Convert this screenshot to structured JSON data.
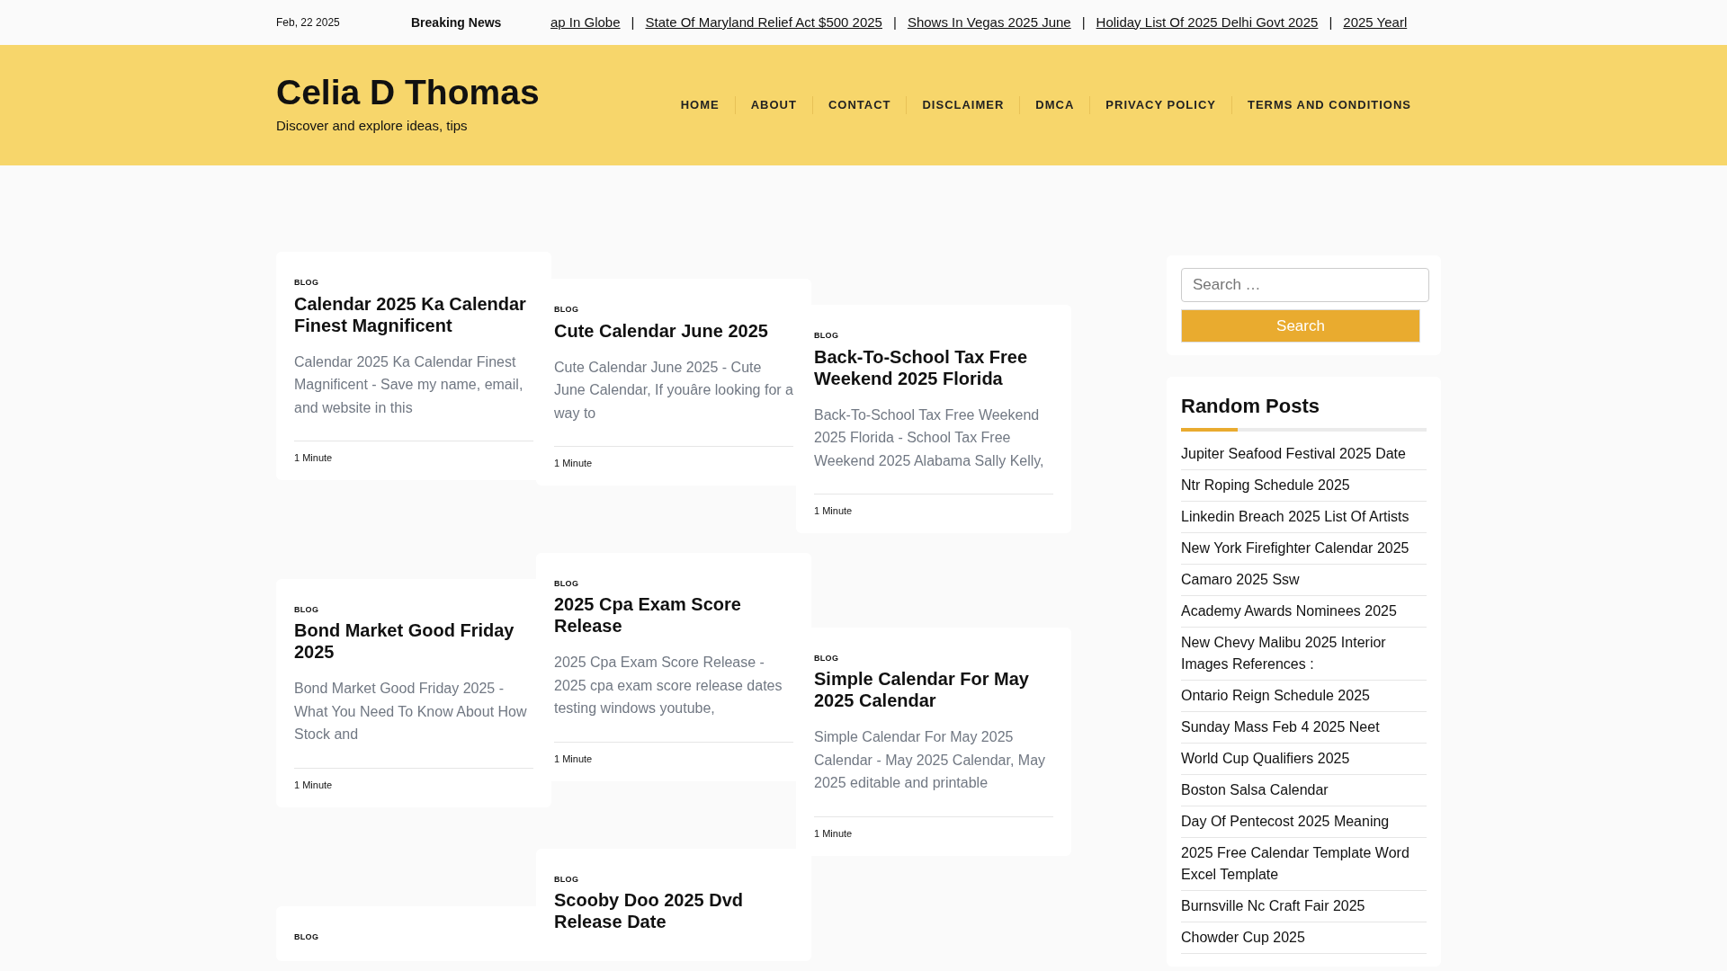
{
  "top_bar": {
    "date": "Feb, 22 2025",
    "breaking_label": "Breaking News",
    "ticker": [
      {
        "title": "ap In Globe"
      },
      {
        "title": "State Of Maryland Relief Act $500 2025"
      },
      {
        "title": "Shows In Vegas 2025 June"
      },
      {
        "title": "Holiday List Of 2025 Delhi Govt 2025"
      },
      {
        "title": "2025 Yearl"
      }
    ],
    "separator": "|"
  },
  "header": {
    "site_title": "Celia D Thomas",
    "tagline": "Discover and explore ideas, tips",
    "nav": [
      "HOME",
      "ABOUT",
      "CONTACT",
      "DISCLAIMER",
      "DMCA",
      "PRIVACY POLICY",
      "TERMS AND CONDITIONS"
    ]
  },
  "card_columns": [
    {
      "cards": [
        {
          "category": "BLOG",
          "title": "Calendar 2025 Ka Calendar Finest Magnificent",
          "excerpt": "Calendar 2025 Ka Calendar Finest Magnificent - Save my name, email, and website in this",
          "read_time": "1 Minute"
        },
        {
          "category": "BLOG",
          "title": "Bond Market Good Friday 2025",
          "excerpt": "Bond Market Good Friday 2025 - What You Need To Know About How Stock and",
          "read_time": "1 Minute"
        },
        {
          "category": "BLOG"
        }
      ]
    },
    {
      "cards": [
        {
          "category": "BLOG",
          "title": "Cute Calendar June 2025",
          "excerpt": "Cute Calendar June 2025 - Cute June Calendar, If youâre looking for a way to",
          "read_time": "1 Minute"
        },
        {
          "category": "BLOG",
          "title": "2025 Cpa Exam Score Release",
          "excerpt": "2025 Cpa Exam Score Release - 2025 cpa exam score release dates testing windows youtube,",
          "read_time": "1 Minute"
        },
        {
          "category": "BLOG",
          "title": "Scooby Doo 2025 Dvd Release Date"
        }
      ]
    },
    {
      "cards": [
        {
          "category": "BLOG",
          "title": "Back-To-School Tax Free Weekend 2025 Florida",
          "excerpt": "Back-To-School Tax Free Weekend 2025 Florida - School Tax Free Weekend 2025 Alabama Sally Kelly,",
          "read_time": "1 Minute"
        },
        {
          "category": "BLOG",
          "title": "Simple Calendar For May 2025 Calendar",
          "excerpt": "Simple Calendar For May 2025 Calendar - May 2025 Calendar, May 2025 editable and printable",
          "read_time": "1 Minute"
        }
      ]
    }
  ],
  "sidebar": {
    "search": {
      "placeholder": "Search …",
      "button": "Search"
    },
    "random_posts": {
      "title": "Random Posts",
      "items": [
        "Jupiter Seafood Festival 2025 Date",
        "Ntr Roping Schedule 2025",
        "Linkedin Breach 2025 List Of Artists",
        "New York Firefighter Calendar 2025",
        "Camaro 2025 Ssw",
        "Academy Awards Nominees 2025",
        "New Chevy Malibu 2025 Interior Images References :",
        "Ontario Reign Schedule 2025",
        "Sunday Mass Feb 4 2025 Neet",
        "World Cup Qualifiers 2025",
        "Boston Salsa Calendar",
        "Day Of Pentecost 2025 Meaning",
        "2025 Free Calendar Template Word Excel Template",
        "Burnsville Nc Craft Fair 2025",
        "Chowder Cup 2025"
      ]
    }
  }
}
